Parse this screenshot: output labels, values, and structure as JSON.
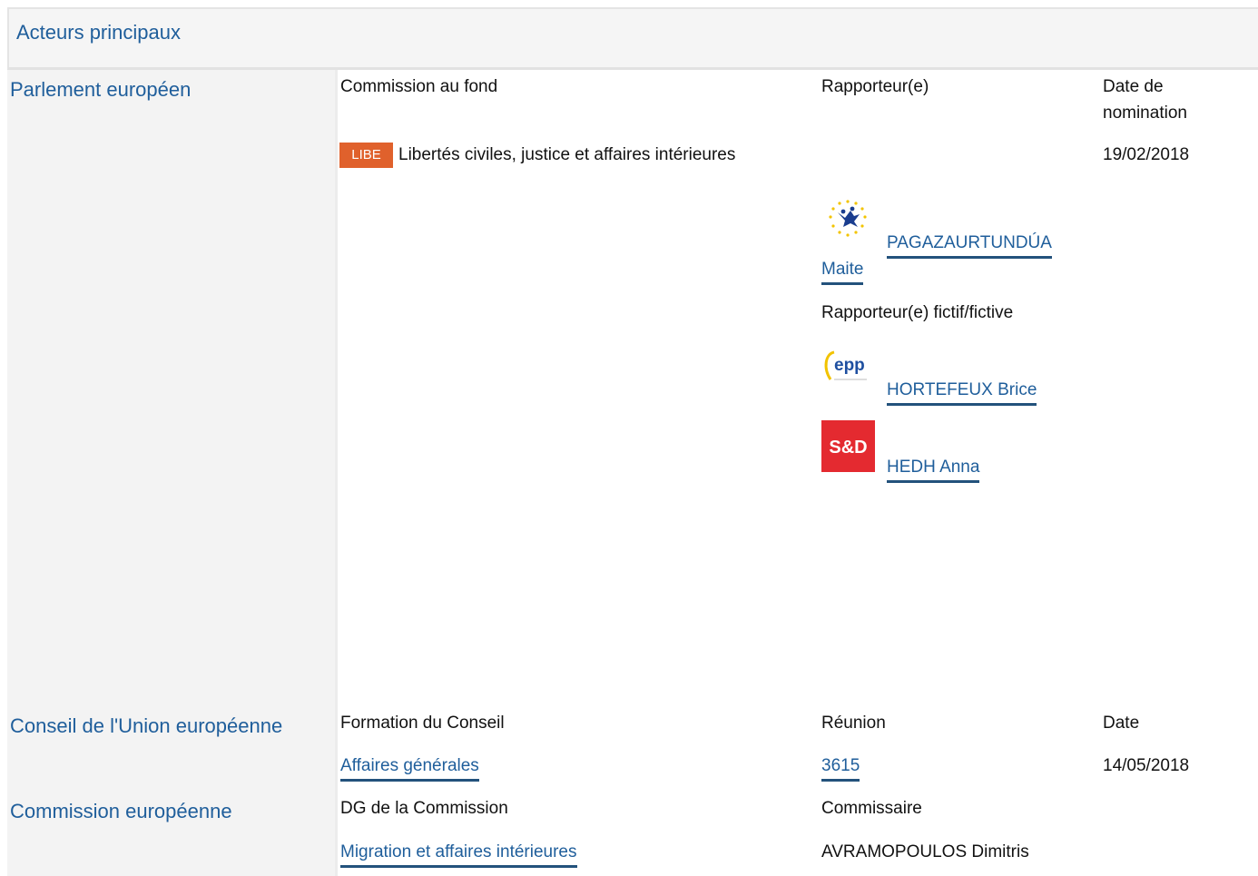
{
  "header": {
    "title": "Acteurs principaux"
  },
  "parliament": {
    "label": "Parlement européen",
    "col_committee": "Commission au fond",
    "col_rapporteur": "Rapporteur(e)",
    "col_date_line1": "Date de",
    "col_date_line2": "nomination",
    "committee_badge": "LIBE",
    "committee_name": "Libertés civiles, justice et affaires intérieures",
    "nomination_date": "19/02/2018",
    "rapporteur_name_line1": "PAGAZAURTUNDÚA",
    "rapporteur_name_line2": "Maite",
    "shadow_label": "Rapporteur(e) fictif/fictive",
    "shadow_1": "HORTEFEUX Brice",
    "shadow_2": "HEDH Anna",
    "logo_sd": "S&D",
    "logo_epp": "epp"
  },
  "council": {
    "label": "Conseil de l'Union européenne",
    "col_formation": "Formation du Conseil",
    "col_meeting": "Réunion",
    "col_date": "Date",
    "formation": "Affaires générales",
    "meeting": "3615",
    "date": "14/05/2018"
  },
  "commission": {
    "label": "Commission européenne",
    "col_dg": "DG de la Commission",
    "col_commissioner": "Commissaire",
    "dg": "Migration et affaires intérieures",
    "commissioner": "AVRAMOPOULOS Dimitris"
  },
  "colors": {
    "link": "#1f5e9b",
    "badge": "#e0612c",
    "sd": "#e42a30"
  }
}
